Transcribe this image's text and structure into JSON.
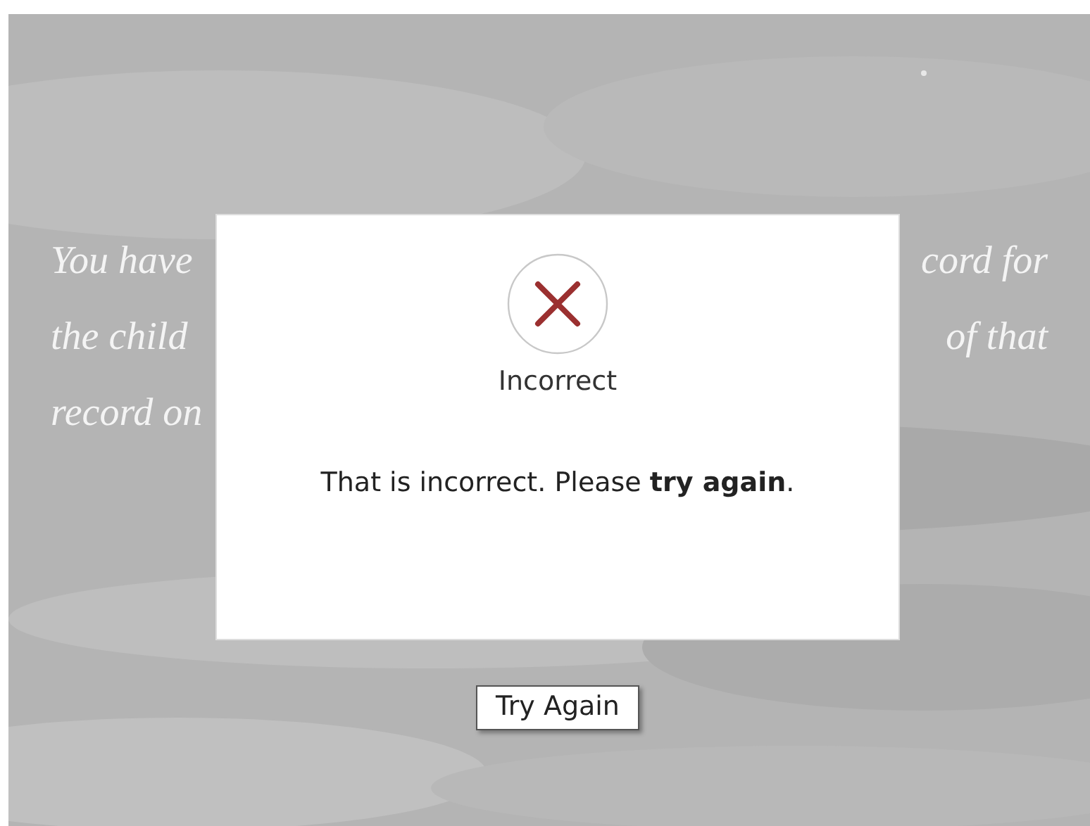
{
  "background_text": [
    {
      "left": "You have",
      "right": "cord for"
    },
    {
      "left": "the child",
      "right": "of that"
    },
    {
      "left": "record on"
    }
  ],
  "dialog": {
    "title": "Incorrect",
    "message": "That is incorrect. Please **try again**."
  },
  "button": "Try Again"
}
